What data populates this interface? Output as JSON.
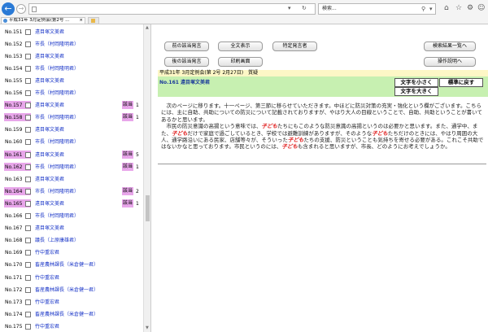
{
  "browser": {
    "search_placeholder": "検索...",
    "tabs": [
      {
        "label": "平成31年 3月定例会(第2号 ..."
      }
    ]
  },
  "buttons": {
    "prev_speaker": "前の該当発言",
    "show_all": "全文表示",
    "specific_speaker": "特定発言者",
    "next_speaker": "後の該当発言",
    "print": "印刷画面",
    "back_to_results": "検索結果一覧へ",
    "instructions": "操作説明へ",
    "text_smaller": "文字を小さく",
    "text_reset": "標準に戻す",
    "text_larger": "文字を大きく"
  },
  "meeting": {
    "title": "平成31年 3月定例会(第 2号 2月27日)　質疑"
  },
  "speaker": {
    "label": "No.161 遠目塚文美君"
  },
  "body_lines": [
    {
      "parts": [
        "　次のページに移ります。十一ページ、第三節に移らせていただきます。中ほどに防災対策の充実・強化という欄がございます。こちらには、主に自助、共助についての防災について記載されておりますが、やはり大人の目線ということで、自助、共助ということが書いてあるかと思います。"
      ]
    },
    {
      "parts": [
        "　市民の防災意識の高揚という意味では、",
        "子ども",
        "たちにもこのような防災意識の高揚というのは必要かと思います。また、通学中、また、",
        "子ども",
        "だけで家庭で過ごしているとき、学校では避難訓練がありますが、そのような",
        "子ども",
        "たちだけのときには、やはり周囲の大人、通学路沿いにある民家、店舗等々が、そういった",
        "子ども",
        "たちの支援、防災ということも気持ちを寄せる必要がある。これこそ共助ではないかなと思っております。市民というのには、",
        "子ども",
        "も含まれると思いますが、市長、どのようにお考えでしょうか。"
      ]
    }
  ],
  "list": [
    {
      "num": "No.151",
      "name": "遠目塚文美君",
      "badge": "",
      "count": "",
      "hl": false
    },
    {
      "num": "No.152",
      "name": "市長（村岡隆明君）",
      "badge": "",
      "count": "",
      "hl": false
    },
    {
      "num": "No.153",
      "name": "遠目塚文美君",
      "badge": "",
      "count": "",
      "hl": false
    },
    {
      "num": "No.154",
      "name": "市長（村岡隆明君）",
      "badge": "",
      "count": "",
      "hl": false
    },
    {
      "num": "No.155",
      "name": "遠目塚文美君",
      "badge": "",
      "count": "",
      "hl": false
    },
    {
      "num": "No.156",
      "name": "市長（村岡隆明君）",
      "badge": "",
      "count": "",
      "hl": false
    },
    {
      "num": "No.157",
      "name": "遠目塚文美君",
      "badge": "該当",
      "count": "1",
      "hl": true
    },
    {
      "num": "No.158",
      "name": "市長（村岡隆明君）",
      "badge": "該当",
      "count": "1",
      "hl": true
    },
    {
      "num": "No.159",
      "name": "遠目塚文美君",
      "badge": "",
      "count": "",
      "hl": false
    },
    {
      "num": "No.160",
      "name": "市長（村岡隆明君）",
      "badge": "",
      "count": "",
      "hl": false
    },
    {
      "num": "No.161",
      "name": "遠目塚文美君",
      "badge": "該当",
      "count": "5",
      "hl": true
    },
    {
      "num": "No.162",
      "name": "市長（村岡隆明君）",
      "badge": "該当",
      "count": "1",
      "hl": true
    },
    {
      "num": "No.163",
      "name": "遠目塚文美君",
      "badge": "",
      "count": "",
      "hl": false
    },
    {
      "num": "No.164",
      "name": "市長（村岡隆明君）",
      "badge": "該当",
      "count": "2",
      "hl": true
    },
    {
      "num": "No.165",
      "name": "遠目塚文美君",
      "badge": "該当",
      "count": "1",
      "hl": true
    },
    {
      "num": "No.166",
      "name": "市長（村岡隆明君）",
      "badge": "",
      "count": "",
      "hl": false
    },
    {
      "num": "No.167",
      "name": "遠目塚文美君",
      "badge": "",
      "count": "",
      "hl": false
    },
    {
      "num": "No.168",
      "name": "議長（上原康雄君）",
      "badge": "",
      "count": "",
      "hl": false
    },
    {
      "num": "No.169",
      "name": "竹中重宏君",
      "badge": "",
      "count": "",
      "hl": false
    },
    {
      "num": "No.170",
      "name": "畜産農林課長（米倉健一君）",
      "badge": "",
      "count": "",
      "hl": false
    },
    {
      "num": "No.171",
      "name": "竹中重宏君",
      "badge": "",
      "count": "",
      "hl": false
    },
    {
      "num": "No.172",
      "name": "畜産農林課長（米倉健一君）",
      "badge": "",
      "count": "",
      "hl": false
    },
    {
      "num": "No.173",
      "name": "竹中重宏君",
      "badge": "",
      "count": "",
      "hl": false
    },
    {
      "num": "No.174",
      "name": "畜産農林課長（米倉健一君）",
      "badge": "",
      "count": "",
      "hl": false
    },
    {
      "num": "No.175",
      "name": "竹中重宏君",
      "badge": "",
      "count": "",
      "hl": false
    }
  ]
}
